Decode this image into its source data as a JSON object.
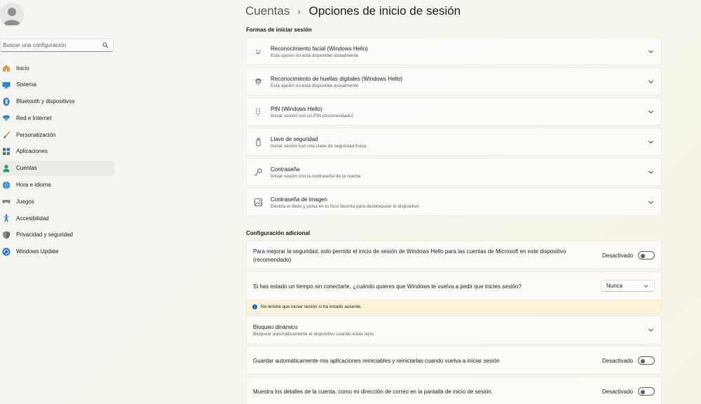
{
  "sidebar": {
    "search_placeholder": "Buscar una configuración",
    "items": [
      {
        "label": "Inicio",
        "icon": "home-icon"
      },
      {
        "label": "Sistema",
        "icon": "system-icon"
      },
      {
        "label": "Bluetooth y dispositivos",
        "icon": "bluetooth-icon"
      },
      {
        "label": "Red e Internet",
        "icon": "wifi-icon"
      },
      {
        "label": "Personalización",
        "icon": "brush-icon"
      },
      {
        "label": "Aplicaciones",
        "icon": "apps-icon"
      },
      {
        "label": "Cuentas",
        "icon": "person-icon",
        "selected": true
      },
      {
        "label": "Hora e idioma",
        "icon": "globe-clock-icon"
      },
      {
        "label": "Juegos",
        "icon": "gamepad-icon"
      },
      {
        "label": "Accesibilidad",
        "icon": "accessibility-icon"
      },
      {
        "label": "Privacidad y seguridad",
        "icon": "shield-icon"
      },
      {
        "label": "Windows Update",
        "icon": "update-icon"
      }
    ]
  },
  "header": {
    "parent": "Cuentas",
    "separator": "›",
    "title": "Opciones de inicio de sesión"
  },
  "signin_section": {
    "title": "Formas de iniciar sesión",
    "options": [
      {
        "title": "Reconocimiento facial (Windows Hello)",
        "subtitle": "Esta opción no está disponible actualmente",
        "icon": "face-icon"
      },
      {
        "title": "Reconocimiento de huellas digitales (Windows Hello)",
        "subtitle": "Esta opción no está disponible actualmente",
        "icon": "fingerprint-icon"
      },
      {
        "title": "PIN (Windows Hello)",
        "subtitle": "Iniciar sesión con un PIN (recomendado)",
        "icon": "pin-keypad-icon"
      },
      {
        "title": "Llave de seguridad",
        "subtitle": "Iniciar sesión con una clave de seguridad física",
        "icon": "usb-key-icon"
      },
      {
        "title": "Contraseña",
        "subtitle": "Iniciar sesión con la contraseña de la cuenta",
        "icon": "key-icon"
      },
      {
        "title": "Contraseña de imagen",
        "subtitle": "Desliza el dedo y pulsa en tu foco favorita para desbloquear el dispositivo",
        "icon": "image-icon"
      }
    ]
  },
  "additional_section": {
    "title": "Configuración adicional",
    "hello_only": {
      "line1": "Para mejorar la seguridad, solo permitir el inicio de sesión de Windows Hello para las cuentas de Microsoft en este dispositivo",
      "line2": "(recomendado)",
      "state": "Desactivado"
    },
    "away": {
      "label": "Si has estado un tiempo sin conectarte, ¿cuándo quieres que Windows te vuelva a pedir que inicies sesión?",
      "value": "Nunca",
      "info": "No tendrá que iniciar sesión si ha estado ausente."
    },
    "dynamic_lock": {
      "title": "Bloqueo dinámico",
      "subtitle": "Bloquear automáticamente el dispositivo cuando estás lejos"
    },
    "restart_apps": {
      "label": "Guardar automáticamente mis aplicaciones reiniciables y reiniciarlas cuando vuelva a iniciar sesión",
      "state": "Desactivado"
    },
    "account_details": {
      "label": "Muestra los detalles de la cuenta, como mi dirección de correo en la pantalla de inicio de sesión.",
      "state": "Desactivado"
    }
  },
  "colors": {
    "accent": "#0067c0",
    "toggle_off": "#5c5c5c",
    "info_bar": "#fbf3d6"
  }
}
